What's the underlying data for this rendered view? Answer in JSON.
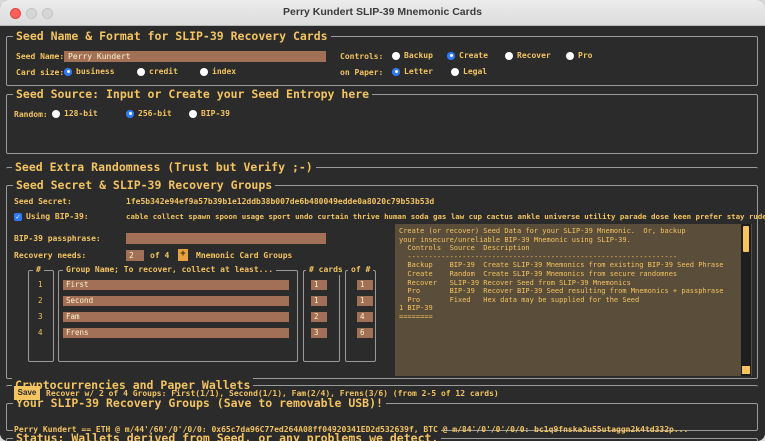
{
  "window": {
    "title": "Perry Kundert SLIP-39 Mnemonic Cards"
  },
  "seed_name_format": {
    "title": "Seed Name & Format for SLIP-39 Recovery Cards",
    "seed_name_label": "Seed Name:",
    "seed_name_value": "Perry Kundert",
    "card_size_label": "Card size:",
    "card_sizes": [
      "business",
      "credit",
      "index"
    ],
    "card_size_selected": "business",
    "controls_label": "Controls:",
    "controls": [
      "Backup",
      "Create",
      "Recover",
      "Pro"
    ],
    "controls_selected": "Create",
    "paper_label": "on Paper:",
    "papers": [
      "Letter",
      "Legal"
    ],
    "paper_selected": "Letter"
  },
  "seed_source": {
    "title": "Seed Source: Input or Create your Seed Entropy here",
    "random_label": "Random:",
    "options": [
      "128-bit",
      "256-bit",
      "BIP-39"
    ],
    "selected": "256-bit"
  },
  "extra_randomness": {
    "title": "Seed Extra Randomness (Trust but Verify ;-)"
  },
  "secret_groups": {
    "title": "Seed Secret & SLIP-39 Recovery Groups",
    "seed_secret_label": "Seed Secret:",
    "seed_secret_value": "1fe5b342e94ef9a57b39b1e12ddb38b007de6b480049edde0a8020c79b53b53d",
    "using_bip39_label": "Using BIP-39:",
    "bip39_words": "cable collect spawn spoon usage sport undo curtain thrive human soda gas law cup cactus ankle universe utility parade dose keen prefer stay rude",
    "passphrase_label": "BIP-39 passphrase:",
    "passphrase_value": "",
    "recovery_needs_label": "Recovery needs:",
    "recovery_needs_value": "2",
    "of_label": "of 4",
    "plus": "+",
    "mnemonic_groups_label": "Mnemonic Card Groups",
    "col_num": "#",
    "col_group": "Group Name; To recover, collect at least...",
    "col_cards": "# cards",
    "col_of": "of #",
    "groups": [
      {
        "num": "1",
        "name": "First",
        "need": "1",
        "of": "1"
      },
      {
        "num": "2",
        "name": "Second",
        "need": "1",
        "of": "1"
      },
      {
        "num": "3",
        "name": "Fam",
        "need": "2",
        "of": "4"
      },
      {
        "num": "4",
        "name": "Frens",
        "need": "3",
        "of": "6"
      }
    ]
  },
  "info": {
    "lines": [
      "Create (or recover) Seed Data for your SLIP-39 Mnemonic.  Or, backup",
      "your insecure/unreliable BIP-39 Mnemonic using SLIP-39.",
      "",
      "  Controls  Source  Description",
      "  ----------------------------------------------------------------",
      "  Backup    BIP-39  Create SLIP-39 Mnemonics from existing BIP-39 Seed Phrase",
      "  Create    Random  Create SLIP-39 Mnemonics from secure randomnes",
      "  Recover   SLIP-39 Recover Seed from SLIP-39 Mnemonics",
      "  Pro       BIP-39  Recover BIP-39 Seed resulting from Mnemonics + passphrase",
      "  Pro       Fixed   Hex data may be supplied for the Seed",
      "",
      "",
      "1 BIP-39",
      "========"
    ]
  },
  "crypto": {
    "title": "Cryptocurrencies and Paper Wallets"
  },
  "usb": {
    "title": "Your SLIP-39 Recovery Groups (Save to removable USB)!",
    "save_label": "Save",
    "summary": "Recover w/ 2 of 4 Groups: First(1/1), Second(1/1), Fam(2/4), Frens(3/6) (from 2-5 of 12 cards)"
  },
  "status": {
    "title": "Status; Wallets derived from Seed, or any problems we detect.",
    "text": "Perry Kundert == ETH @ m/44'/60'/0'/0/0: 0x65c7da96C77ed264A08ff04920341ED2d532639f, BTC @ m/84'/0'/0'/0/0: bc1q9fnska3u55utaggn2k4td332p..."
  },
  "colors": {
    "accent": "#f3c460",
    "field": "#a26f57",
    "radio_selected": "#2f7bf6",
    "background": "#2b2b2b"
  }
}
